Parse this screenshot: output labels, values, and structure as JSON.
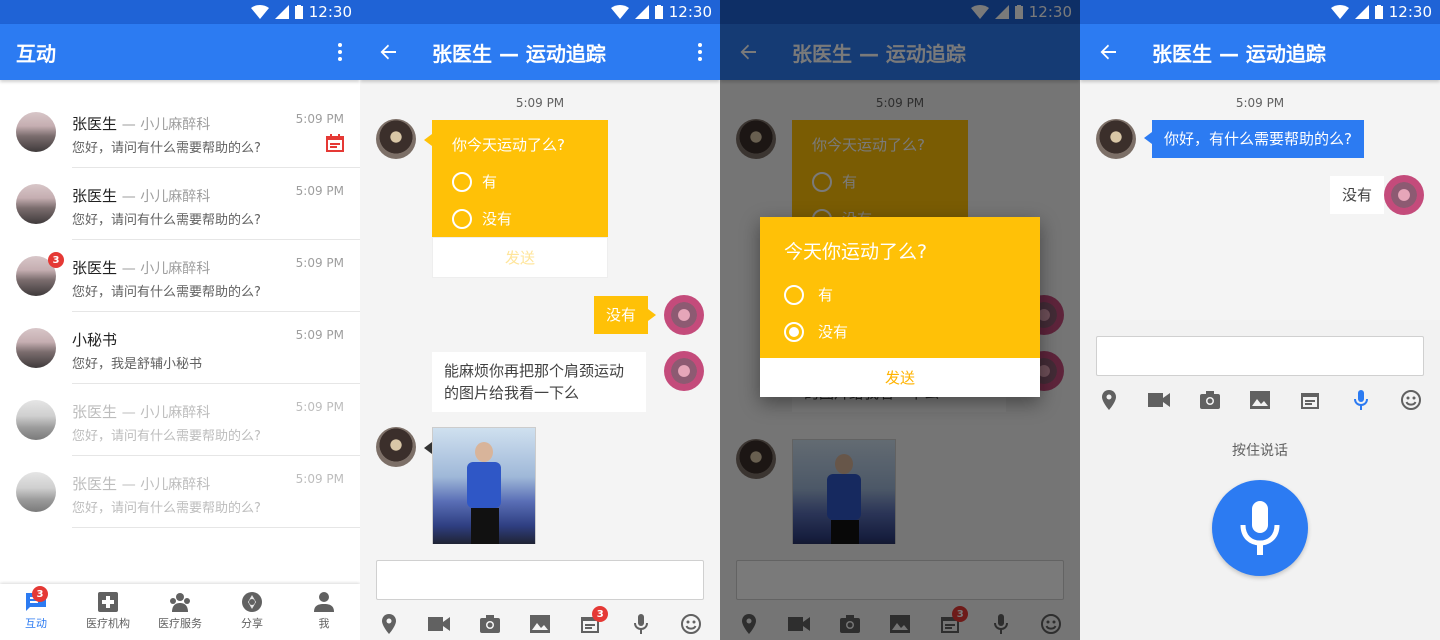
{
  "status": {
    "time": "12:30"
  },
  "colors": {
    "primary": "#2c7bf2",
    "status_bar": "#1f63d6",
    "accent_yellow": "#ffc107",
    "badge_red": "#e53935"
  },
  "list_screen": {
    "title": "互动",
    "conversations": [
      {
        "name": "张医生",
        "dept": "— 小儿麻醉科",
        "message": "您好，请问有什么需要帮助的么?",
        "time": "5:09 PM",
        "badge": "",
        "icon": "calendar-icon"
      },
      {
        "name": "张医生",
        "dept": "— 小儿麻醉科",
        "message": "您好，请问有什么需要帮助的么?",
        "time": "5:09 PM",
        "badge": ""
      },
      {
        "name": "张医生",
        "dept": "— 小儿麻醉科",
        "message": "您好，请问有什么需要帮助的么?",
        "time": "5:09 PM",
        "badge": "3"
      },
      {
        "name": "小秘书",
        "dept": "",
        "message": "您好，我是舒辅小秘书",
        "time": "5:09 PM",
        "badge": ""
      },
      {
        "name": "张医生",
        "dept": "— 小儿麻醉科",
        "message": "您好，请问有什么需要帮助的么?",
        "time": "5:09 PM",
        "badge": ""
      },
      {
        "name": "张医生",
        "dept": "— 小儿麻醉科",
        "message": "您好，请问有什么需要帮助的么?",
        "time": "5:09 PM",
        "badge": ""
      }
    ],
    "nav": [
      {
        "label": "互动",
        "icon": "chat-icon",
        "badge": "3"
      },
      {
        "label": "医疗机构",
        "icon": "medical-cross-icon"
      },
      {
        "label": "医疗服务",
        "icon": "people-icon"
      },
      {
        "label": "分享",
        "icon": "camera-aperture-icon"
      },
      {
        "label": "我",
        "icon": "person-icon"
      }
    ]
  },
  "chat": {
    "title": "张医生 — 运动追踪",
    "time": "5:09 PM",
    "survey": {
      "question": "你今天运动了么?",
      "options": [
        "有",
        "没有"
      ],
      "send": "发送"
    },
    "reply_1": "没有",
    "message_2": "能麻烦你再把那个肩颈运动的图片给我看一下么",
    "toolbar_badge": "3"
  },
  "dialog": {
    "question": "今天你运动了么?",
    "options": [
      "有",
      "没有"
    ],
    "send": "发送"
  },
  "voice": {
    "doctor_message": "你好，有什么需要帮助的么?",
    "reply": "没有",
    "hint": "按住说话"
  }
}
